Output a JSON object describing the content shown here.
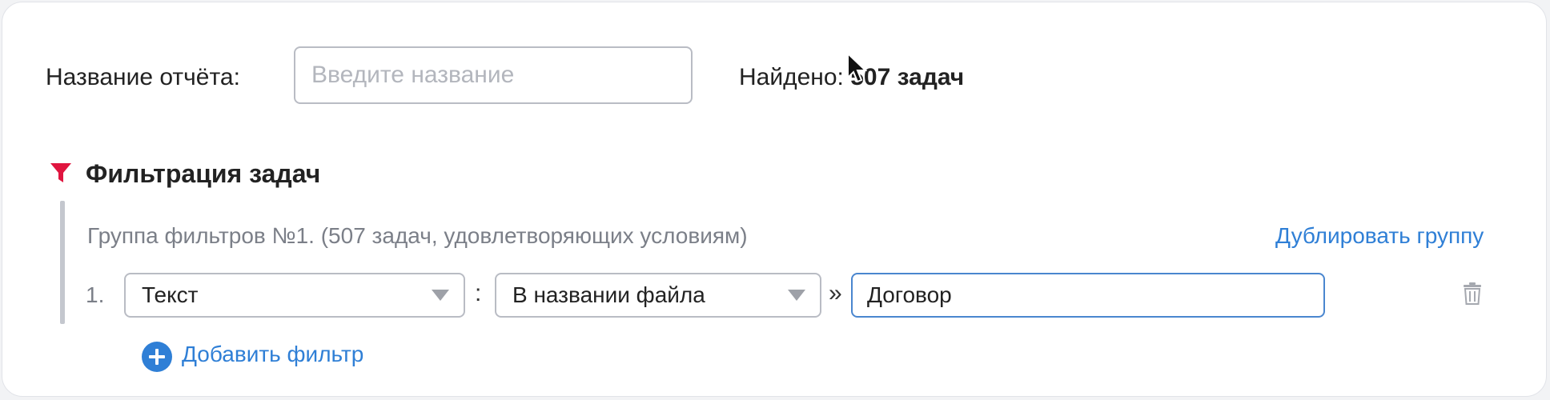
{
  "report": {
    "label": "Название отчёта:",
    "name_placeholder": "Введите название",
    "name_value": "",
    "found_prefix": "Найдено:",
    "found_count": "507 задач"
  },
  "filtering": {
    "title": "Фильтрация задач",
    "icon": "funnel-icon",
    "accent_color": "#e0153f",
    "group": {
      "title": "Группа фильтров №1. (507 задач, удовлетворяющих условиям)",
      "duplicate_label": "Дублировать группу",
      "filters": [
        {
          "number": "1.",
          "type": "Текст",
          "separator": ":",
          "field": "В названии файла",
          "arrow": "»",
          "value": "Договор"
        }
      ]
    },
    "add_filter_label": "Добавить фильтр",
    "link_color": "#2f7fd6"
  }
}
